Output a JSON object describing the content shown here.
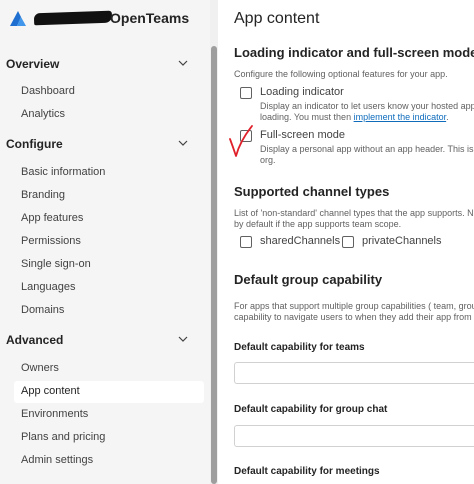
{
  "app": {
    "name": "OpenTeams"
  },
  "sidebar": {
    "sections": [
      {
        "title": "Overview",
        "items": [
          "Dashboard",
          "Analytics"
        ]
      },
      {
        "title": "Configure",
        "items": [
          "Basic information",
          "Branding",
          "App features",
          "Permissions",
          "Single sign-on",
          "Languages",
          "Domains"
        ]
      },
      {
        "title": "Advanced",
        "items": [
          "Owners",
          "App content",
          "Environments",
          "Plans and pricing",
          "Admin settings"
        ]
      }
    ],
    "active_item": "App content"
  },
  "main": {
    "title": "App content",
    "loading": {
      "heading": "Loading indicator and full-screen mode",
      "description": "Configure the following optional features for your app.",
      "loading_indicator": {
        "label": "Loading indicator",
        "desc_line1": "Display an indicator to let users know your hosted app c",
        "desc_line2_prefix": "loading. You must then ",
        "desc_link": "implement the indicator",
        "desc_line2_suffix": ".",
        "checked": false
      },
      "full_screen": {
        "label": "Full-screen mode",
        "desc_line1": "Display a personal app without an app header. This is su",
        "desc_line2": "org.",
        "checked": false
      },
      "annotation_color": "#e0202a"
    },
    "channels": {
      "heading": "Supported channel types",
      "desc_line1": "List of 'non-standard' channel types that the app supports. Not",
      "desc_line2": "by default if the app supports team scope.",
      "options": [
        {
          "label": "sharedChannels",
          "checked": false
        },
        {
          "label": "privateChannels",
          "checked": false
        }
      ]
    },
    "group": {
      "heading": "Default group capability",
      "desc_line1": "For apps that support multiple group capabilities ( team, group",
      "desc_line2": "capability to navigate users to when they add their app from t",
      "fields": [
        {
          "label": "Default capability for teams",
          "value": ""
        },
        {
          "label": "Default capability for group chat",
          "value": ""
        },
        {
          "label": "Default capability for meetings",
          "value": ""
        }
      ]
    }
  },
  "colors": {
    "sidebar_bg": "#f5f5f5",
    "link": "#0f6cbd",
    "brand_blue": "#0f6cbd"
  }
}
